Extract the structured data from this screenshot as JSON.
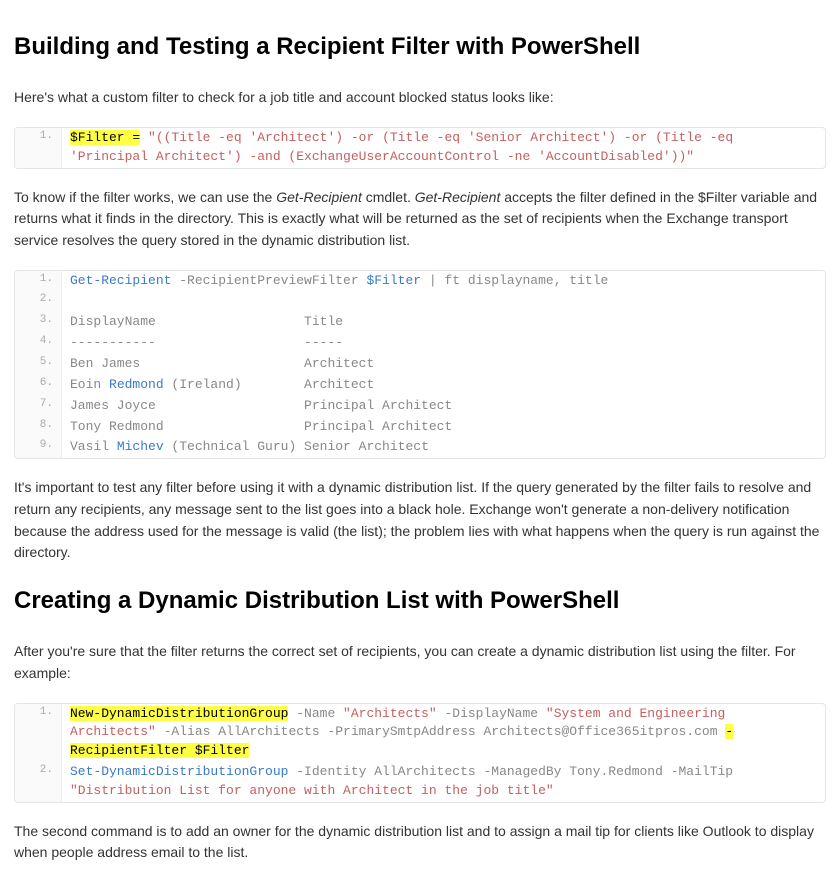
{
  "heading1": "Building and Testing a Recipient Filter with PowerShell",
  "p1a": "Here's what a custom filter to check for a job title and account blocked status looks like:",
  "code1": {
    "ln1": "1.",
    "l1a": "$Filter =",
    "l1b": " ",
    "l1c": "\"((Title -eq 'Architect') -or (Title -eq 'Senior Architect') -or (Title -eq 'Principal Architect') -and (ExchangeUserAccountControl -ne 'AccountDisabled'))\""
  },
  "p2a": "To know if the filter works, we can use the ",
  "p2b": "Get-Recipient",
  "p2c": " cmdlet. ",
  "p2d": "Get-Recipient",
  "p2e": " accepts the filter defined in the $Filter variable and returns what it finds in the directory. This is exactly what will be returned as the set of recipients when the Exchange transport service resolves the query stored in the dynamic distribution list.",
  "code2": {
    "ln": [
      "1.",
      "2.",
      "3.",
      "4.",
      "5.",
      "6.",
      "7.",
      "8.",
      "9."
    ],
    "l1a": "Get-Recipient",
    "l1b": " -RecipientPreviewFilter ",
    "l1c": "$Filter",
    "l1d": " | ft displayname, title",
    "l2": " ",
    "l3": "DisplayName                   Title",
    "l4": "-----------                   -----",
    "l5": "Ben James                     Architect",
    "l6a": "Eoin ",
    "l6b": "Redmond",
    "l6c": " (Ireland)        Architect",
    "l7": "James Joyce                   Principal Architect",
    "l8": "Tony Redmond                  Principal Architect",
    "l9a": "Vasil ",
    "l9b": "Michev",
    "l9c": " (Technical Guru) Senior Architect"
  },
  "p3": "It's important to test any filter before using it with a dynamic distribution list. If the query generated by the filter fails to resolve and return any recipients, any message sent to the list goes into a black hole. Exchange won't generate a non-delivery notification because the address used for the message is valid (the list); the problem lies with what happens when the query is run against the directory.",
  "heading2": "Creating a Dynamic Distribution List with PowerShell",
  "p4": "After you're sure that the filter returns the correct set of recipients, you can create a dynamic distribution list using the filter. For example:",
  "code3": {
    "ln1": "1.",
    "ln2": "2.",
    "l1a": "New-DynamicDistributionGroup",
    "l1b": " -Name ",
    "l1c": "\"Architects\"",
    "l1d": " -DisplayName ",
    "l1e": "\"System and Engineering Architects\"",
    "l1f": " -Alias AllArchitects -PrimarySmtpAddress Architects@Office365itpros.com ",
    "l1g": "-RecipientFilter $Filter",
    "l2a": "Set-DynamicDistributionGroup",
    "l2b": " -Identity AllArchitects -ManagedBy Tony.Redmond -MailTip ",
    "l2c": "\"Distribution List for anyone with Architect in the job title\""
  },
  "p5": "The second command is to add an owner for the dynamic distribution list and to assign a mail tip for clients like Outlook to display when people address email to the list."
}
